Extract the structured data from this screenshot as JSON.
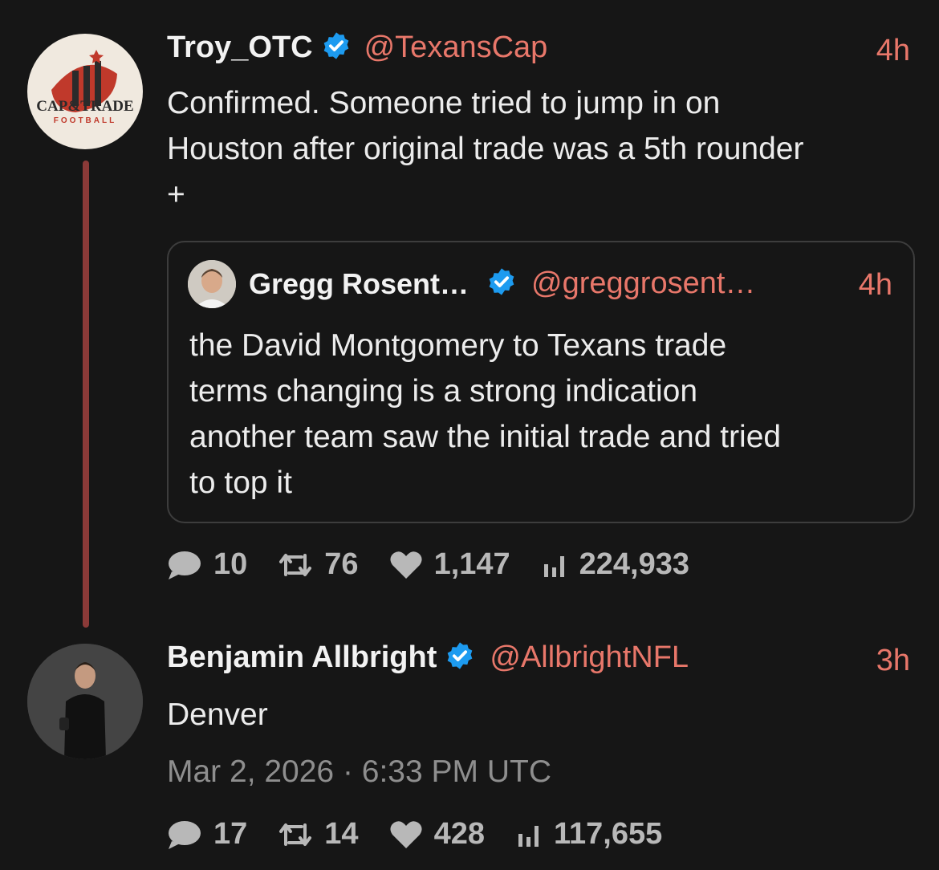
{
  "tweet1": {
    "name": "Troy_OTC",
    "handle": "@TexansCap",
    "time": "4h",
    "text_lines": [
      "Confirmed. Someone tried to jump in on",
      "Houston after original trade was a 5th rounder",
      "+"
    ],
    "avatar_logo": {
      "line1": "CAP&TRADE",
      "line2": "FOOTBALL"
    },
    "quote": {
      "name": "Gregg Rosent…",
      "handle": "@greggrosent…",
      "time": "4h",
      "text_lines": [
        "the David Montgomery to Texans trade",
        "terms changing is a strong indication",
        "another team saw the initial trade and tried",
        "to top it"
      ]
    },
    "stats": {
      "replies": "10",
      "retweets": "76",
      "likes": "1,147",
      "views": "224,933"
    }
  },
  "tweet2": {
    "name": "Benjamin Allbright",
    "handle": "@AllbrightNFL",
    "time": "3h",
    "text": "Denver",
    "date": "Mar 2, 2026 · 6:33 PM UTC",
    "stats": {
      "replies": "17",
      "retweets": "14",
      "likes": "428",
      "views": "117,655"
    }
  },
  "colors": {
    "background": "#161616",
    "accent": "#e8776a",
    "verified": "#1d9bf0",
    "thread_line": "#8b3a38"
  }
}
